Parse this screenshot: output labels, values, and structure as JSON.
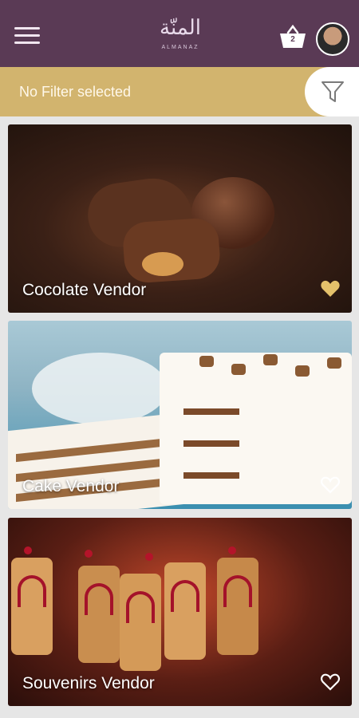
{
  "header": {
    "logo_script": "المنّة",
    "logo_sub": "ALMANAZ",
    "cart_count": "2"
  },
  "filter": {
    "status_text": "No Filter selected"
  },
  "vendors": [
    {
      "name": "Cocolate Vendor",
      "favorited": true
    },
    {
      "name": "Cake Vendor",
      "favorited": false
    },
    {
      "name": "Souvenirs  Vendor",
      "favorited": false
    }
  ],
  "colors": {
    "app_bar": "#5a3a55",
    "filter_bar": "#d2b46e",
    "heart_active": "#e4c16b",
    "heart_outline": "#ffffff"
  },
  "icons": {
    "menu": "hamburger-icon",
    "cart": "basket-icon",
    "filter": "funnel-icon",
    "favorite": "heart-icon"
  }
}
